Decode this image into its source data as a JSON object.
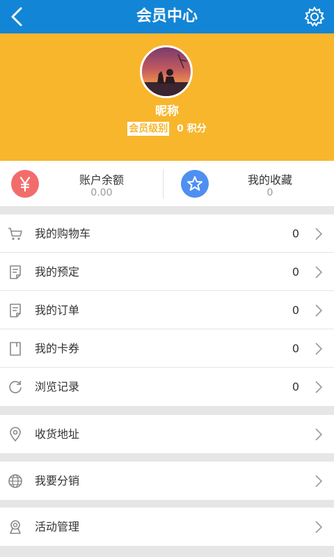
{
  "header": {
    "title": "会员中心"
  },
  "profile": {
    "nickname": "昵称",
    "level": "会员级别",
    "points": "0 积分"
  },
  "stats": [
    {
      "label": "账户余额",
      "value": "0.00",
      "icon": "yen-icon",
      "color": "#f36c6c"
    },
    {
      "label": "我的收藏",
      "value": "0",
      "icon": "star-icon",
      "color": "#4e8ff2"
    }
  ],
  "menu_group1": [
    {
      "label": "我的购物车",
      "count": "0",
      "icon": "cart-icon"
    },
    {
      "label": "我的预定",
      "count": "0",
      "icon": "reservation-icon"
    },
    {
      "label": "我的订单",
      "count": "0",
      "icon": "order-icon"
    },
    {
      "label": "我的卡券",
      "count": "0",
      "icon": "coupon-icon"
    },
    {
      "label": "浏览记录",
      "count": "0",
      "icon": "history-icon"
    }
  ],
  "menu_group2": [
    {
      "label": "收货地址",
      "icon": "location-icon"
    }
  ],
  "menu_group3": [
    {
      "label": "我要分销",
      "icon": "globe-icon"
    }
  ],
  "menu_group4": [
    {
      "label": "活动管理",
      "icon": "award-icon"
    }
  ],
  "colors": {
    "header": "#1385d6",
    "profile_bg": "#f8b62c",
    "page_bg": "#e6e6e6"
  }
}
